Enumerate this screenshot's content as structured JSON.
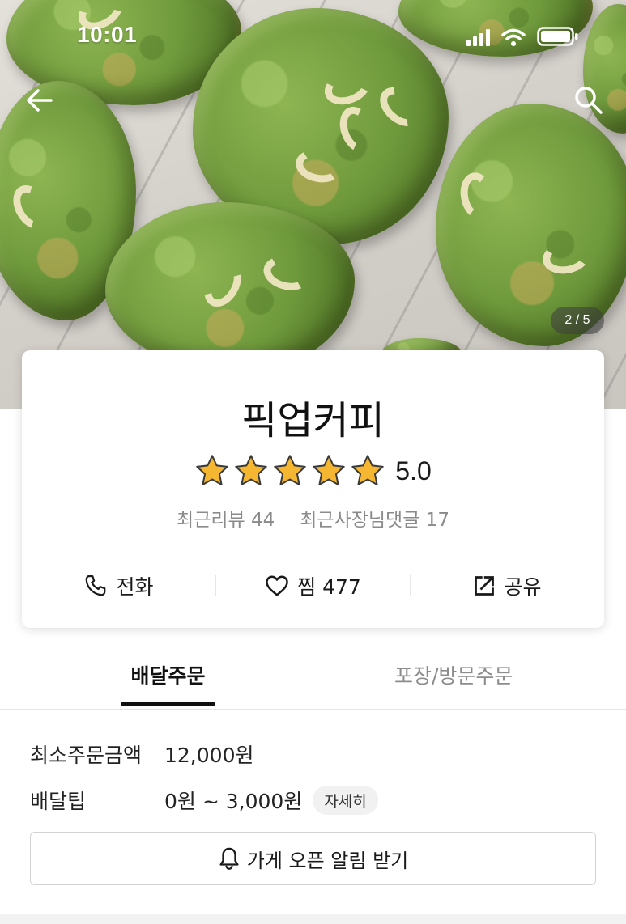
{
  "status_bar": {
    "time": "10:01"
  },
  "hero": {
    "page_indicator": "2 / 5",
    "back_icon": "arrow-left-icon",
    "search_icon": "search-icon"
  },
  "store": {
    "name": "픽업커피",
    "rating": "5.0",
    "stars": 5,
    "recent_reviews": "최근리뷰 44",
    "owner_replies": "최근사장님댓글 17"
  },
  "actions": {
    "call_label": "전화",
    "like_label": "찜 477",
    "share_label": "공유"
  },
  "tabs": {
    "delivery_label": "배달주문",
    "pickup_label": "포장/방문주문",
    "active": "delivery"
  },
  "info": {
    "min_order_label": "최소주문금액",
    "min_order_value": "12,000원",
    "delivery_tip_label": "배달팁",
    "delivery_tip_value": "0원 ~ 3,000원",
    "detail_label": "자세히"
  },
  "notify_button": {
    "label": "가게 오픈 알림 받기"
  },
  "colors": {
    "star": "#f5b731",
    "tab_active": "#111111",
    "tab_inactive": "#8c8c8c",
    "cookie_green": "#6f9a3c"
  }
}
